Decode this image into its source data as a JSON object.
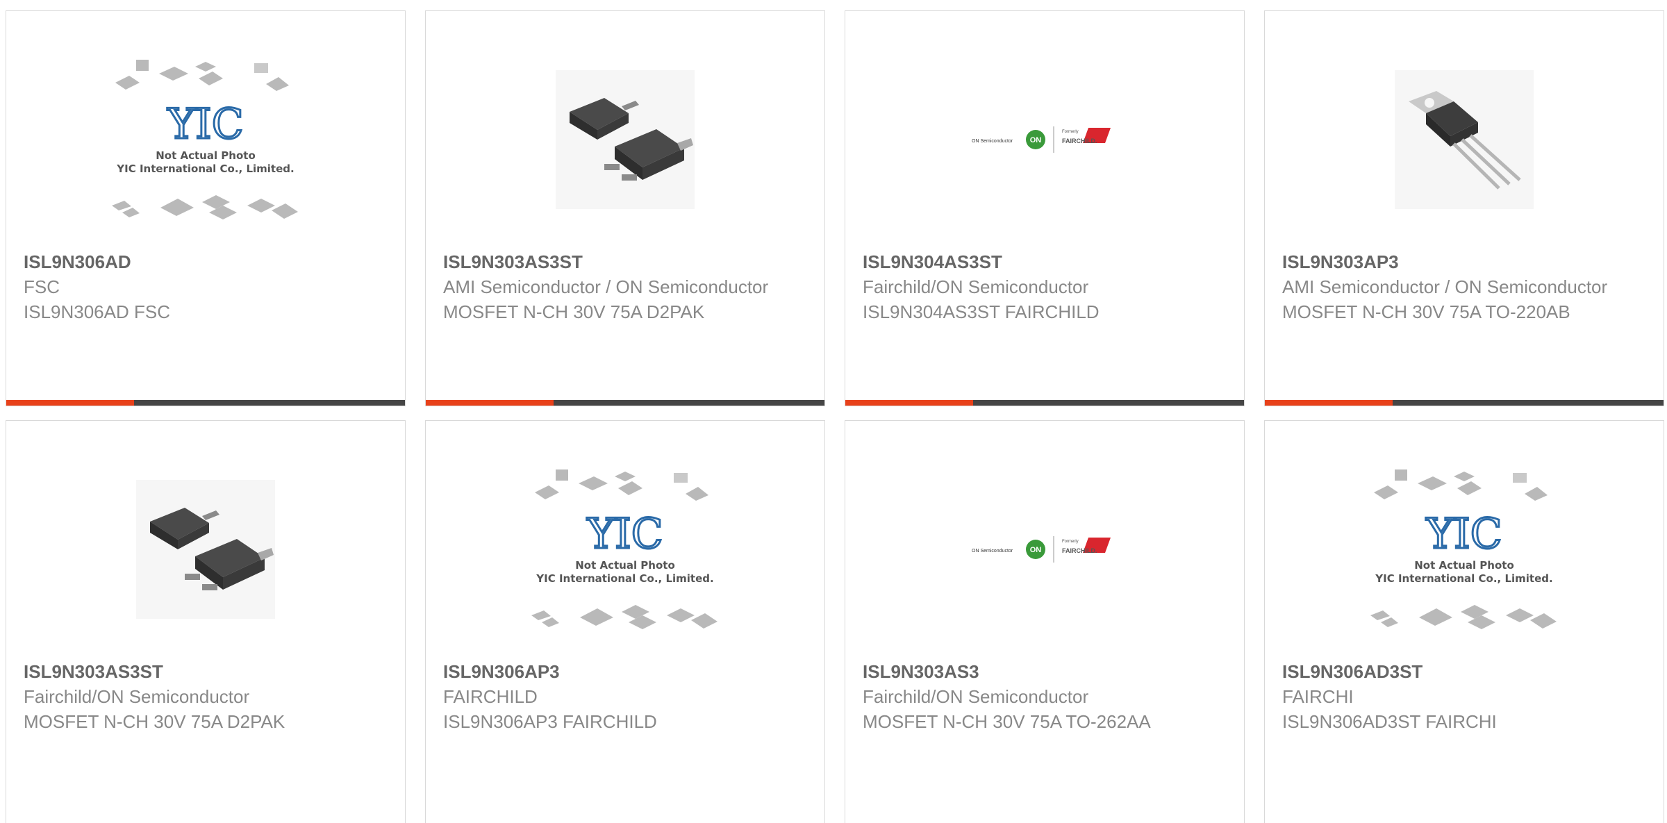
{
  "products": [
    {
      "part_number": "ISL9N306AD",
      "manufacturer": "FSC",
      "description": "ISL9N306AD FSC",
      "image": "yic-placeholder",
      "image_caption_1": "Not Actual Photo",
      "image_caption_2": "YIC International Co., Limited.",
      "image_logo": "YIC"
    },
    {
      "part_number": "ISL9N303AS3ST",
      "manufacturer": "AMI Semiconductor / ON Semiconductor",
      "description": "MOSFET N-CH 30V 75A D2PAK",
      "image": "d2pak-package"
    },
    {
      "part_number": "ISL9N304AS3ST",
      "manufacturer": "Fairchild/ON Semiconductor",
      "description": "ISL9N304AS3ST FAIRCHILD",
      "image": "onsemi-fairchild-logo",
      "image_logo_1": "ON Semiconductor",
      "image_logo_2": "ON",
      "image_logo_3": "Formerly",
      "image_logo_4": "FAIRCHILD."
    },
    {
      "part_number": "ISL9N303AP3",
      "manufacturer": "AMI Semiconductor / ON Semiconductor",
      "description": "MOSFET N-CH 30V 75A TO-220AB",
      "image": "to220-package"
    },
    {
      "part_number": "ISL9N303AS3ST",
      "manufacturer": "Fairchild/ON Semiconductor",
      "description": "MOSFET N-CH 30V 75A D2PAK",
      "image": "d2pak-package"
    },
    {
      "part_number": "ISL9N306AP3",
      "manufacturer": "FAIRCHILD",
      "description": "ISL9N306AP3 FAIRCHILD",
      "image": "yic-placeholder",
      "image_caption_1": "Not Actual Photo",
      "image_caption_2": "YIC International Co., Limited.",
      "image_logo": "YIC"
    },
    {
      "part_number": "ISL9N303AS3",
      "manufacturer": "Fairchild/ON Semiconductor",
      "description": "MOSFET N-CH 30V 75A TO-262AA",
      "image": "onsemi-fairchild-logo",
      "image_logo_1": "ON Semiconductor",
      "image_logo_2": "ON",
      "image_logo_3": "Formerly",
      "image_logo_4": "FAIRCHILD."
    },
    {
      "part_number": "ISL9N306AD3ST",
      "manufacturer": "FAIRCHI",
      "description": "ISL9N306AD3ST FAIRCHI",
      "image": "yic-placeholder",
      "image_caption_1": "Not Actual Photo",
      "image_caption_2": "YIC International Co., Limited.",
      "image_logo": "YIC"
    }
  ],
  "colors": {
    "accent": "#e8411a",
    "bar": "#454545",
    "border": "#d9d9d9",
    "title": "#666666",
    "text": "#888888"
  }
}
